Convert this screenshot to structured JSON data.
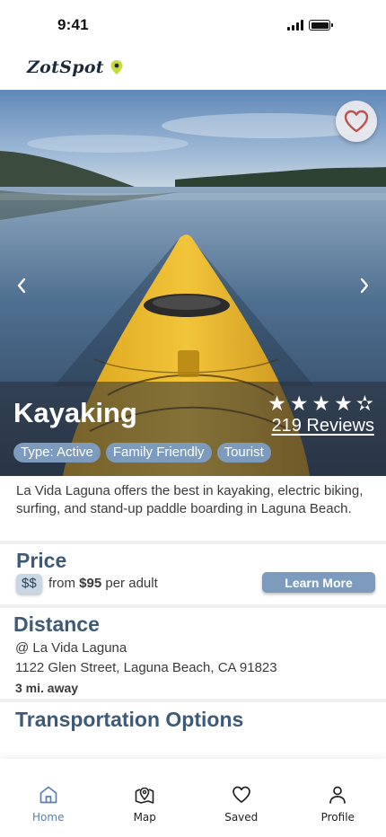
{
  "status_bar": {
    "time": "9:41"
  },
  "brand": {
    "name": "ZotSpot"
  },
  "hero": {
    "title": "Kayaking",
    "rating": 4.5,
    "reviews": "219 Reviews",
    "tags": [
      "Type: Active",
      "Family Friendly",
      "Tourist"
    ]
  },
  "description": "La Vida Laguna offers the best in kayaking, electric biking, surfing, and stand-up paddle boarding in Laguna Beach.",
  "price": {
    "title": "Price",
    "badge": "$$",
    "from": "from",
    "amount": "$95",
    "unit": "per adult",
    "button": "Learn More"
  },
  "distance": {
    "title": "Distance",
    "place": "@ La Vida Laguna",
    "address": "1122 Glen Street, Laguna Beach, CA 91823",
    "away": "3 mi. away"
  },
  "transportation": {
    "title": "Transportation Options"
  },
  "tabbar": {
    "items": [
      {
        "label": "Home",
        "icon": "home-icon",
        "active": true
      },
      {
        "label": "Map",
        "icon": "map-pin-icon",
        "active": false
      },
      {
        "label": "Saved",
        "icon": "heart-icon",
        "active": false
      },
      {
        "label": "Profile",
        "icon": "user-icon",
        "active": false
      }
    ]
  },
  "colors": {
    "accent": "#7d9bbd",
    "section_title": "#3f5a77",
    "active_tab": "#5a7fb0",
    "favorite_heart": "#c0504d"
  }
}
